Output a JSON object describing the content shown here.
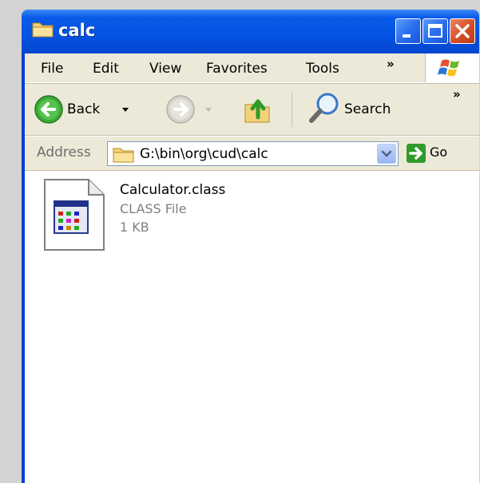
{
  "window": {
    "title": "calc"
  },
  "menubar": {
    "items": [
      {
        "label": "File"
      },
      {
        "label": "Edit"
      },
      {
        "label": "View"
      },
      {
        "label": "Favorites"
      },
      {
        "label": "Tools"
      }
    ],
    "overflow": "»"
  },
  "toolbar": {
    "back_label": "Back",
    "search_label": "Search",
    "overflow": "»"
  },
  "address": {
    "label": "Address",
    "path": "G:\\bin\\org\\cud\\calc",
    "go_label": "Go"
  },
  "files": [
    {
      "name": "Calculator.class",
      "type": "CLASS File",
      "size": "1 KB"
    }
  ],
  "colors": {
    "titlebar": "#0554e3",
    "chrome": "#ece9d8",
    "close": "#d9502a"
  },
  "icons": {
    "title": "folder-icon",
    "back": "back-arrow-icon",
    "forward": "forward-arrow-icon",
    "up": "up-folder-icon",
    "search": "magnifier-icon",
    "go": "go-arrow-icon",
    "file": "class-file-icon"
  }
}
